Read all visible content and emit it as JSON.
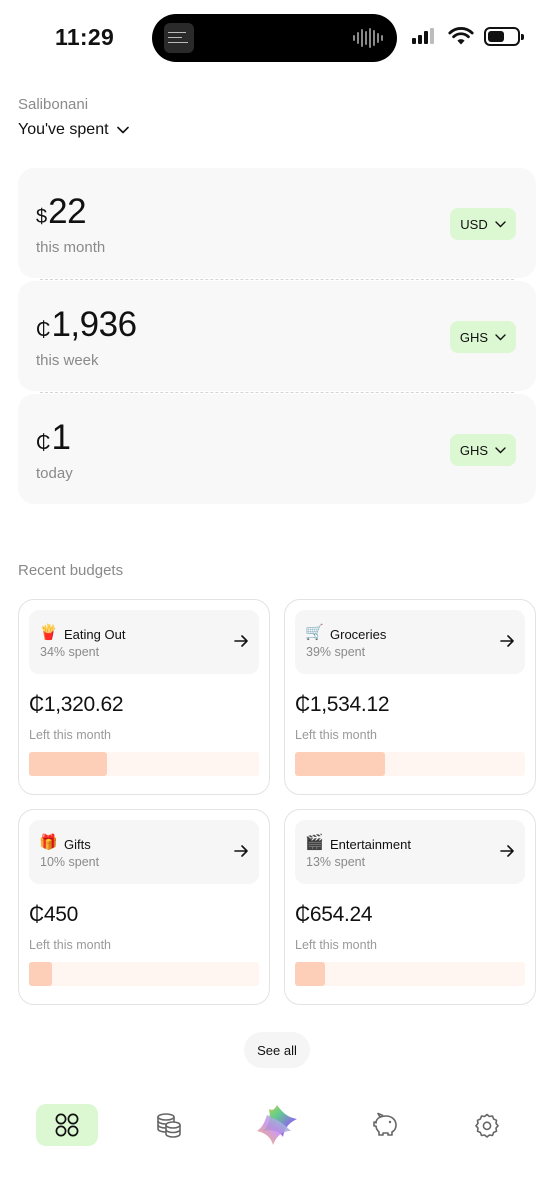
{
  "status_bar": {
    "time": "11:29",
    "island_art_icon": "album-art-icon",
    "audio_wave_icon": "audio-waveform-icon",
    "signal_icon": "cellular-signal-icon",
    "wifi_icon": "wifi-icon",
    "battery_icon": "battery-icon"
  },
  "header": {
    "greeting": "Salibonani",
    "spent_label": "You've spent"
  },
  "spending": [
    {
      "symbol": "$",
      "amount": "22",
      "period": "this month",
      "currency": "USD"
    },
    {
      "symbol": "₵",
      "amount": "1,936",
      "period": "this week",
      "currency": "GHS"
    },
    {
      "symbol": "₵",
      "amount": "1",
      "period": "today",
      "currency": "GHS"
    }
  ],
  "budgets": {
    "title": "Recent budgets",
    "items": [
      {
        "emoji": "🍟",
        "name": "Eating Out",
        "percent_label": "34% spent",
        "amount": "₵1,320.62",
        "subtitle": "Left this month",
        "progress": 0.34
      },
      {
        "emoji": "🛒",
        "name": "Groceries",
        "percent_label": "39% spent",
        "amount": "₵1,534.12",
        "subtitle": "Left this month",
        "progress": 0.39
      },
      {
        "emoji": "🎁",
        "name": "Gifts",
        "percent_label": "10% spent",
        "amount": "₵450",
        "subtitle": "Left this month",
        "progress": 0.1
      },
      {
        "emoji": "🎬",
        "name": "Entertainment",
        "percent_label": "13% spent",
        "amount": "₵654.24",
        "subtitle": "Left this month",
        "progress": 0.13
      }
    ],
    "see_all_label": "See all"
  },
  "nav": {
    "items": [
      {
        "icon": "dashboard-grid-icon",
        "active": true
      },
      {
        "icon": "coins-stack-icon",
        "active": false
      },
      {
        "icon": "app-logo-icon",
        "active": false
      },
      {
        "icon": "piggy-bank-icon",
        "active": false
      },
      {
        "icon": "settings-gear-icon",
        "active": false
      }
    ]
  },
  "colors": {
    "accent_green": "#dcf8d2",
    "progress_fill": "#fdcfb8",
    "progress_track": "#fff5f1",
    "card_bg": "#f8f8f8"
  }
}
